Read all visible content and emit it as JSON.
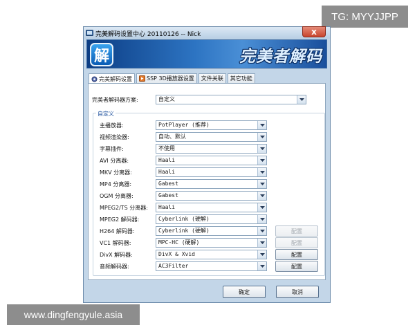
{
  "overlays": {
    "tg_badge": "TG: MYYJJPP",
    "site_badge": "www.dingfengyule.asia"
  },
  "window": {
    "title": "完美解码设置中心 20110126 -- Nick",
    "close_label": "x",
    "banner_logo": "解",
    "banner_brand": "完美者解码"
  },
  "tabs": [
    {
      "label": "完美解码设置",
      "icon": "gear-icon",
      "active": true
    },
    {
      "label": "SSP 3D播放器设置",
      "icon": "player-icon",
      "active": false
    },
    {
      "label": "文件关联",
      "icon": "",
      "active": false
    },
    {
      "label": "其它功能",
      "icon": "",
      "active": false
    }
  ],
  "scheme": {
    "label": "完美者解码器方案:",
    "value": "自定义"
  },
  "group_title": "自定义",
  "rows": [
    {
      "label": "主播放器:",
      "value": "PotPlayer (推荐)"
    },
    {
      "label": "视频渲染器:",
      "value": "自动、默认"
    },
    {
      "label": "字幕插件:",
      "value": "不使用"
    },
    {
      "label": "AVI 分离器:",
      "value": "Haali"
    },
    {
      "label": "MKV 分离器:",
      "value": "Haali"
    },
    {
      "label": "MP4 分离器:",
      "value": "Gabest"
    },
    {
      "label": "OGM 分离器:",
      "value": "Gabest"
    },
    {
      "label": "MPEG2/TS 分离器:",
      "value": "Haali"
    },
    {
      "label": "MPEG2 解码器:",
      "value": "Cyberlink (硬解)"
    },
    {
      "label": "H264 解码器:",
      "value": "Cyberlink (硬解)",
      "config": "配置",
      "config_enabled": false
    },
    {
      "label": "VC1 解码器:",
      "value": "MPC-HC (硬解)",
      "config": "配置",
      "config_enabled": false
    },
    {
      "label": "DivX 解码器:",
      "value": "DivX & Xvid",
      "config": "配置",
      "config_enabled": true
    },
    {
      "label": "音频解码器:",
      "value": "AC3Filter",
      "config": "配置",
      "config_enabled": true
    }
  ],
  "footer": {
    "ok_label": "确定",
    "cancel_label": "取消"
  },
  "colors": {
    "window_bg": "#c3d6e8",
    "banner": "#2d74c2",
    "group_title": "#1b4f9c",
    "close_button": "#c8452d"
  }
}
